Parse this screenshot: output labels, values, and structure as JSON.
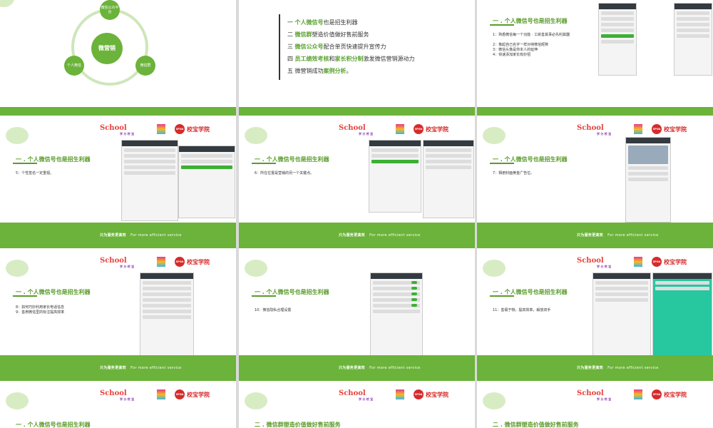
{
  "footer": {
    "cn": "只为服务更高效",
    "en": "For more efficient service"
  },
  "logo": {
    "school": "School",
    "sub": "学 分 校 宝",
    "spoa": "SPOA",
    "academy": "校宝学院"
  },
  "section_title": "一 . 个人微信号也是招生利器",
  "slide1": {
    "center": "微营销",
    "top": "微信公众平台",
    "left": "个人微信",
    "right": "微信群"
  },
  "slide2": {
    "items": [
      {
        "prefix": "一 ",
        "hl": "个人微信号",
        "rest": "也是招生利器"
      },
      {
        "prefix": "二 ",
        "hl": "微信群",
        "rest": "塑造价值做好售前服务"
      },
      {
        "prefix": "三 ",
        "hl": "微信公众号",
        "rest": "配合单页快速提升宣传力"
      },
      {
        "prefix": "四 ",
        "hl": "员工绩效考核",
        "mid": "和",
        "hl2": "家长积分制",
        "rest": "激发微信营销源动力"
      },
      {
        "prefix": "五 微营销成功",
        "hl": "案例分析",
        "rest": "。"
      }
    ]
  },
  "slide3_notes": [
    "1：熟悉微信每一个功能 · 工欲善其事必先利其器",
    "2：像起自己名字一样对待微信昵称",
    "3：微信头像是你本人的延伸",
    "4：快速添加家长有妙招"
  ],
  "slide4_notes": [
    "5：个性签名一定重视。"
  ],
  "slide5_notes": [
    "6：所在位置是营销的另一个关键点。"
  ],
  "slide6_notes": [
    "7：相册封面黄金广告位。"
  ],
  "slide7_notes": [
    "8：如何巧妙利用家长电话信息",
    "9：善用微信里的标注提高效率"
  ],
  "slide8_notes": [
    "10：微信隐私合理设置"
  ],
  "slide9_notes": [
    "11：善假于物，提高效率，解放双手"
  ],
  "bottom_titles": [
    "一 . 个人微信号也是招生利器",
    "二 . 微信群塑造价值做好售前服务",
    "二 . 微信群塑造价值做好售前服务"
  ],
  "colors": {
    "green": "#6bb33a",
    "title_green": "#5a9b2a"
  }
}
